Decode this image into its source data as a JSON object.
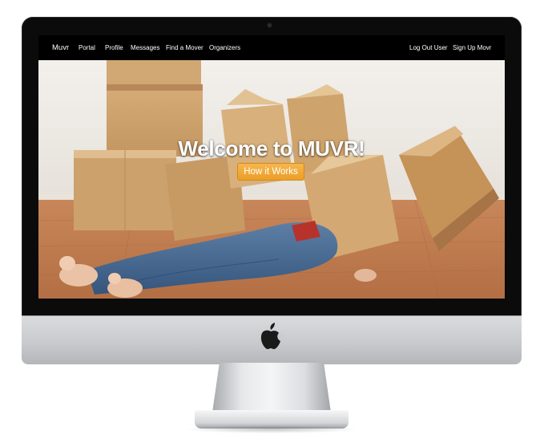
{
  "nav": {
    "brand": "Muvr",
    "items": [
      {
        "label": "Portal"
      },
      {
        "label": "Profile"
      },
      {
        "label": "Messages"
      },
      {
        "label": "Find a Mover"
      },
      {
        "label": "Organizers"
      }
    ],
    "right_items": [
      {
        "label": "Log Out User"
      },
      {
        "label": "Sign Up Movr"
      }
    ]
  },
  "hero": {
    "title": "Welcome to MUVR!",
    "button_label": "How it Works",
    "background_image": "person-buried-under-cardboard-boxes"
  },
  "colors": {
    "accent": "#f0a535",
    "navbar": "#000000",
    "bezel": "#0b0b0b"
  },
  "icons": {
    "chin_logo": "apple-logo-icon"
  }
}
